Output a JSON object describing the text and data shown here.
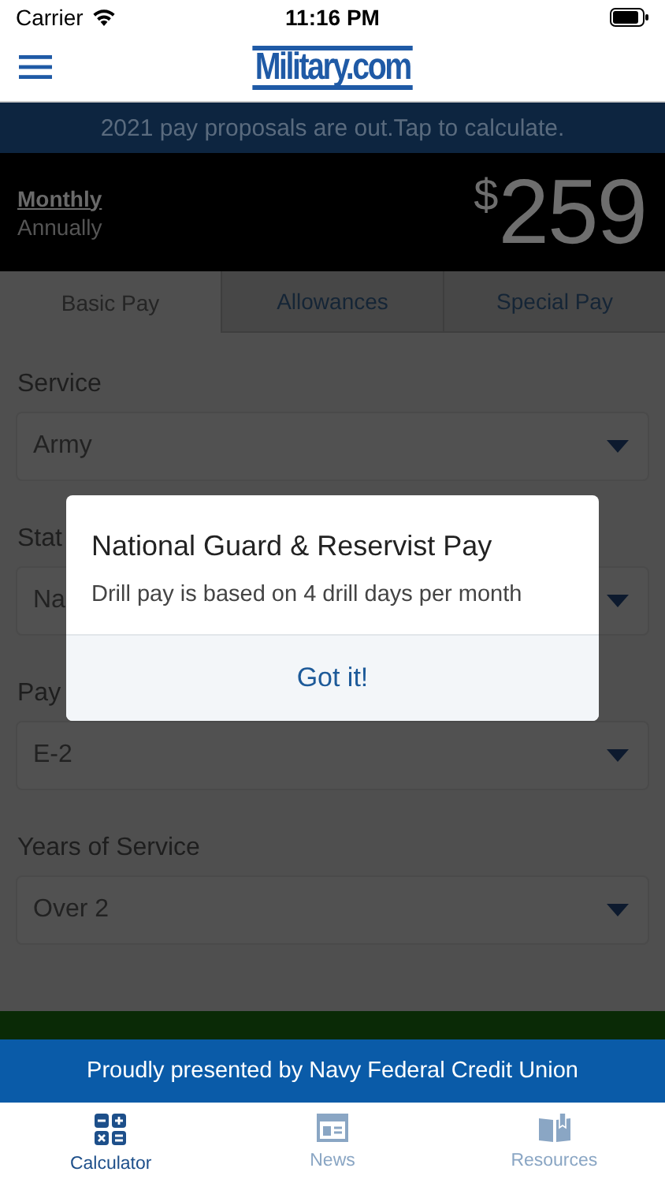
{
  "status_bar": {
    "carrier": "Carrier",
    "time": "11:16 PM"
  },
  "nav_bar": {
    "logo": "Military.com"
  },
  "banner": {
    "text": "2021 pay proposals are out.",
    "link": "Tap to calculate."
  },
  "pay_summary": {
    "periods": [
      {
        "label": "Monthly",
        "selected": true
      },
      {
        "label": "Annually",
        "selected": false
      }
    ],
    "currency": "$",
    "amount": "259"
  },
  "tabs": [
    {
      "label": "Basic Pay",
      "selected": true
    },
    {
      "label": "Allowances",
      "selected": false
    },
    {
      "label": "Special Pay",
      "selected": false
    }
  ],
  "fields": [
    {
      "label": "Service",
      "value": "Army"
    },
    {
      "label": "Stat",
      "value": "Na"
    },
    {
      "label": "Pay",
      "value": "E-2"
    },
    {
      "label": "Years of Service",
      "value": "Over 2"
    }
  ],
  "dialog": {
    "title": "National Guard & Reservist Pay",
    "message": "Drill pay is based on 4 drill days per month",
    "button": "Got it!"
  },
  "sponsor": {
    "text": "Proudly presented by Navy Federal Credit Union"
  },
  "tab_bar": [
    {
      "label": "Calculator",
      "kind": "calculator",
      "selected": true
    },
    {
      "label": "News",
      "kind": "news",
      "selected": false
    },
    {
      "label": "Resources",
      "kind": "book",
      "selected": false
    }
  ]
}
